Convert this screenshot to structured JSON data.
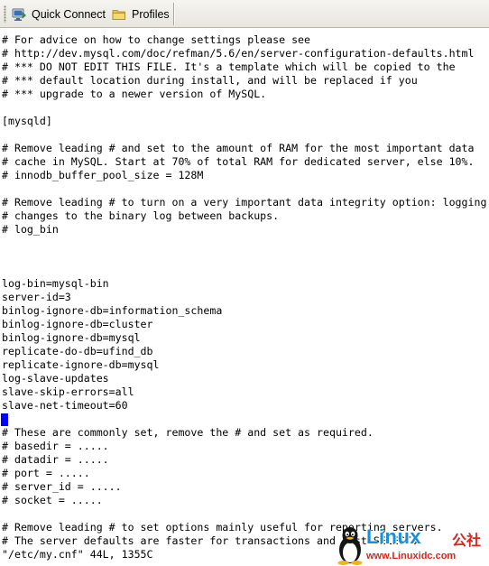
{
  "toolbar": {
    "quick_connect_label": "Quick Connect",
    "profiles_label": "Profiles"
  },
  "terminal": {
    "lines": [
      "# For advice on how to change settings please see",
      "# http://dev.mysql.com/doc/refman/5.6/en/server-configuration-defaults.html",
      "# *** DO NOT EDIT THIS FILE. It's a template which will be copied to the",
      "# *** default location during install, and will be replaced if you",
      "# *** upgrade to a newer version of MySQL.",
      "",
      "[mysqld]",
      "",
      "# Remove leading # and set to the amount of RAM for the most important data",
      "# cache in MySQL. Start at 70% of total RAM for dedicated server, else 10%.",
      "# innodb_buffer_pool_size = 128M",
      "",
      "# Remove leading # to turn on a very important data integrity option: logging",
      "# changes to the binary log between backups.",
      "# log_bin",
      "",
      "",
      "",
      "log-bin=mysql-bin",
      "server-id=3",
      "binlog-ignore-db=information_schema",
      "binlog-ignore-db=cluster",
      "binlog-ignore-db=mysql",
      "replicate-do-db=ufind_db",
      "replicate-ignore-db=mysql",
      "log-slave-updates",
      "slave-skip-errors=all",
      "slave-net-timeout=60",
      "",
      "# These are commonly set, remove the # and set as required.",
      "# basedir = .....",
      "# datadir = .....",
      "# port = .....",
      "# server_id = .....",
      "# socket = .....",
      "",
      "# Remove leading # to set options mainly useful for reporting servers.",
      "# The server defaults are faster for transactions and fast SELECTs.",
      "\"/etc/my.cnf\" 44L, 1355C"
    ],
    "cursor_line": 28,
    "cursor_color": "#0000ff"
  },
  "watermark": {
    "title": "Linux",
    "chinese": "公社",
    "url": "www.Linuxidc.com",
    "title_color": "#1a8fd6",
    "accent_color": "#d8261c"
  }
}
